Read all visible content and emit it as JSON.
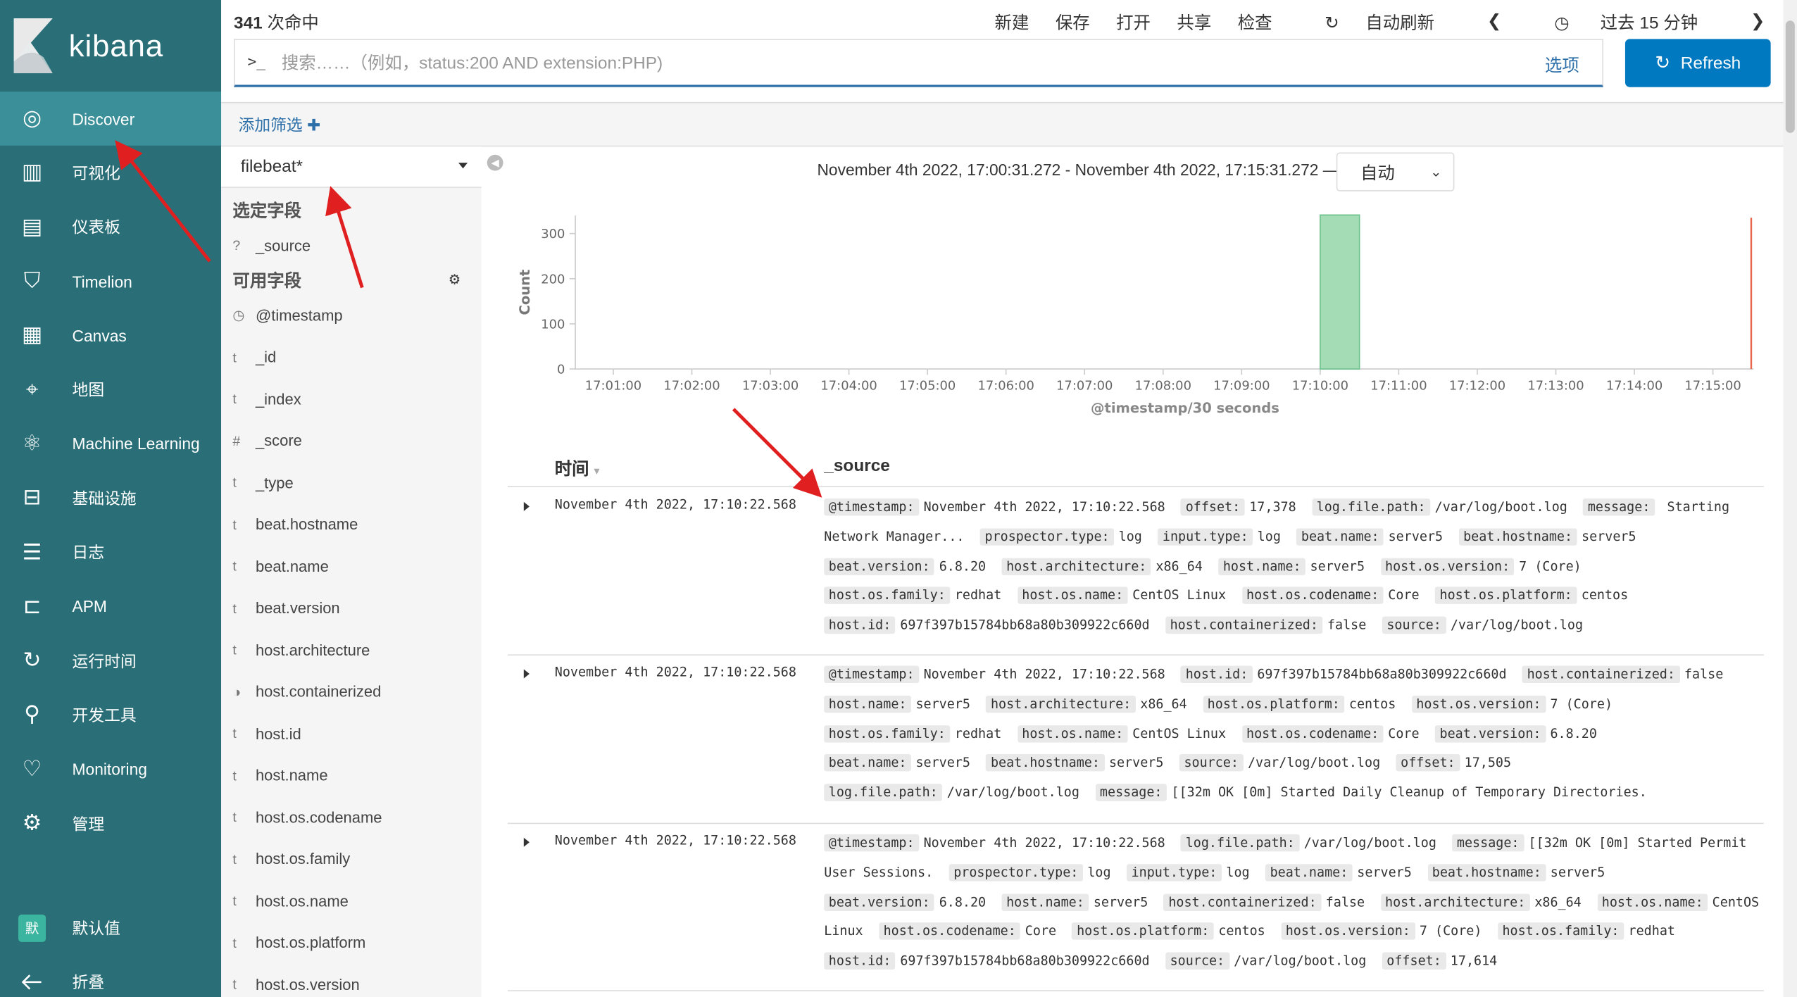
{
  "app": {
    "name": "kibana"
  },
  "nav": {
    "items": [
      {
        "label": "Discover",
        "icon": "compass-icon"
      },
      {
        "label": "可视化",
        "icon": "visualize-icon"
      },
      {
        "label": "仪表板",
        "icon": "dashboard-icon"
      },
      {
        "label": "Timelion",
        "icon": "timelion-icon"
      },
      {
        "label": "Canvas",
        "icon": "canvas-icon"
      },
      {
        "label": "地图",
        "icon": "map-icon"
      },
      {
        "label": "Machine Learning",
        "icon": "ml-icon"
      },
      {
        "label": "基础设施",
        "icon": "infra-icon"
      },
      {
        "label": "日志",
        "icon": "logs-icon"
      },
      {
        "label": "APM",
        "icon": "apm-icon"
      },
      {
        "label": "运行时间",
        "icon": "uptime-icon"
      },
      {
        "label": "开发工具",
        "icon": "devtools-icon"
      },
      {
        "label": "Monitoring",
        "icon": "monitoring-icon"
      },
      {
        "label": "管理",
        "icon": "gear-icon"
      }
    ],
    "user_avatar": "默",
    "user_label": "默认值",
    "collapse_label": "折叠"
  },
  "topbar": {
    "hits_count": "341",
    "hits_label": "次命中",
    "menu": [
      "新建",
      "保存",
      "打开",
      "共享",
      "检查"
    ],
    "auto_refresh": "自动刷新",
    "time_label": "过去 15 分钟",
    "search_prompt": ">_",
    "search_placeholder": "搜索……（例如，status:200 AND extension:PHP)",
    "options_label": "选项",
    "refresh_label": "Refresh"
  },
  "filters": {
    "add_label": "添加筛选"
  },
  "sidebar": {
    "index_pattern": "filebeat*",
    "selected_title": "选定字段",
    "selected_fields": [
      {
        "type": "?",
        "name": "_source"
      }
    ],
    "available_title": "可用字段",
    "available_fields": [
      {
        "type": "clock",
        "name": "@timestamp"
      },
      {
        "type": "t",
        "name": "_id"
      },
      {
        "type": "t",
        "name": "_index"
      },
      {
        "type": "#",
        "name": "_score"
      },
      {
        "type": "t",
        "name": "_type"
      },
      {
        "type": "t",
        "name": "beat.hostname"
      },
      {
        "type": "t",
        "name": "beat.name"
      },
      {
        "type": "t",
        "name": "beat.version"
      },
      {
        "type": "t",
        "name": "host.architecture"
      },
      {
        "type": "bool",
        "name": "host.containerized"
      },
      {
        "type": "t",
        "name": "host.id"
      },
      {
        "type": "t",
        "name": "host.name"
      },
      {
        "type": "t",
        "name": "host.os.codename"
      },
      {
        "type": "t",
        "name": "host.os.family"
      },
      {
        "type": "t",
        "name": "host.os.name"
      },
      {
        "type": "t",
        "name": "host.os.platform"
      },
      {
        "type": "t",
        "name": "host.os.version"
      }
    ]
  },
  "histogram": {
    "range_text": "November 4th 2022, 17:00:31.272 - November 4th 2022, 17:15:31.272 —",
    "interval": "自动"
  },
  "chart_data": {
    "type": "bar",
    "ylabel": "Count",
    "xlabel": "@timestamp/30 seconds",
    "ylim": [
      0,
      340
    ],
    "yticks": [
      0,
      100,
      200,
      300
    ],
    "xticks": [
      "17:01:00",
      "17:02:00",
      "17:03:00",
      "17:04:00",
      "17:05:00",
      "17:06:00",
      "17:07:00",
      "17:08:00",
      "17:09:00",
      "17:10:00",
      "17:11:00",
      "17:12:00",
      "17:13:00",
      "17:14:00",
      "17:15:00"
    ],
    "bars": [
      {
        "x": "17:10:00",
        "value": 341
      }
    ],
    "bar_color": "#a3dcb5",
    "now_marker_color": "#e7664c"
  },
  "docs": {
    "col_time": "时间",
    "col_source": "_source",
    "rows": [
      {
        "time": "November 4th 2022, 17:10:22.568",
        "fields": [
          [
            "@timestamp:",
            "November 4th 2022, 17:10:22.568"
          ],
          [
            "offset:",
            "17,378"
          ],
          [
            "log.file.path:",
            "/var/log/boot.log"
          ],
          [
            "message:",
            " Starting Network Manager..."
          ],
          [
            "prospector.type:",
            "log"
          ],
          [
            "input.type:",
            "log"
          ],
          [
            "beat.name:",
            "server5"
          ],
          [
            "beat.hostname:",
            "server5"
          ],
          [
            "beat.version:",
            "6.8.20"
          ],
          [
            "host.architecture:",
            "x86_64"
          ],
          [
            "host.name:",
            "server5"
          ],
          [
            "host.os.version:",
            "7 (Core)"
          ],
          [
            "host.os.family:",
            "redhat"
          ],
          [
            "host.os.name:",
            "CentOS Linux"
          ],
          [
            "host.os.codename:",
            "Core"
          ],
          [
            "host.os.platform:",
            "centos"
          ],
          [
            "host.id:",
            "697f397b15784bb68a80b309922c660d"
          ],
          [
            "host.containerized:",
            "false"
          ],
          [
            "source:",
            "/var/log/boot.log"
          ]
        ]
      },
      {
        "time": "November 4th 2022, 17:10:22.568",
        "fields": [
          [
            "@timestamp:",
            "November 4th 2022, 17:10:22.568"
          ],
          [
            "host.id:",
            "697f397b15784bb68a80b309922c660d"
          ],
          [
            "host.containerized:",
            "false"
          ],
          [
            "host.name:",
            "server5"
          ],
          [
            "host.architecture:",
            "x86_64"
          ],
          [
            "host.os.platform:",
            "centos"
          ],
          [
            "host.os.version:",
            "7 (Core)"
          ],
          [
            "host.os.family:",
            "redhat"
          ],
          [
            "host.os.name:",
            "CentOS Linux"
          ],
          [
            "host.os.codename:",
            "Core"
          ],
          [
            "beat.version:",
            "6.8.20"
          ],
          [
            "beat.name:",
            "server5"
          ],
          [
            "beat.hostname:",
            "server5"
          ],
          [
            "source:",
            "/var/log/boot.log"
          ],
          [
            "offset:",
            "17,505"
          ],
          [
            "log.file.path:",
            "/var/log/boot.log"
          ],
          [
            "message:",
            "[\u001b[32m OK \u001b[0m] Started Daily Cleanup of Temporary Directories."
          ]
        ]
      },
      {
        "time": "November 4th 2022, 17:10:22.568",
        "fields": [
          [
            "@timestamp:",
            "November 4th 2022, 17:10:22.568"
          ],
          [
            "log.file.path:",
            "/var/log/boot.log"
          ],
          [
            "message:",
            "[\u001b[32m OK \u001b[0m] Started Permit User Sessions."
          ],
          [
            "prospector.type:",
            "log"
          ],
          [
            "input.type:",
            "log"
          ],
          [
            "beat.name:",
            "server5"
          ],
          [
            "beat.hostname:",
            "server5"
          ],
          [
            "beat.version:",
            "6.8.20"
          ],
          [
            "host.name:",
            "server5"
          ],
          [
            "host.containerized:",
            "false"
          ],
          [
            "host.architecture:",
            "x86_64"
          ],
          [
            "host.os.name:",
            "CentOS Linux"
          ],
          [
            "host.os.codename:",
            "Core"
          ],
          [
            "host.os.platform:",
            "centos"
          ],
          [
            "host.os.version:",
            "7 (Core)"
          ],
          [
            "host.os.family:",
            "redhat"
          ],
          [
            "host.id:",
            "697f397b15784bb68a80b309922c660d"
          ],
          [
            "source:",
            "/var/log/boot.log"
          ],
          [
            "offset:",
            "17,614"
          ]
        ]
      }
    ]
  }
}
